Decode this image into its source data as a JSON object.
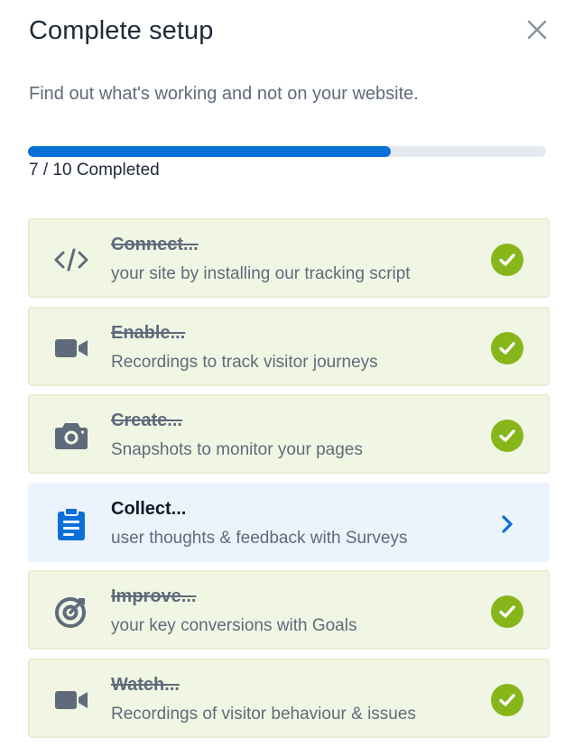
{
  "header": {
    "title": "Complete setup",
    "subtitle": "Find out what's working and not on your website."
  },
  "progress": {
    "completed": 7,
    "total": 10,
    "fraction": 0.7,
    "label": "7 / 10 Completed",
    "fill_color": "#0a6fd6"
  },
  "tasks": [
    {
      "title": "Connect...",
      "description": "your site by installing our tracking script",
      "icon": "code-icon",
      "status": "completed"
    },
    {
      "title": "Enable...",
      "description": "Recordings to track visitor journeys",
      "icon": "video-camera-icon",
      "status": "completed"
    },
    {
      "title": "Create...",
      "description": "Snapshots to monitor your pages",
      "icon": "camera-icon",
      "status": "completed"
    },
    {
      "title": "Collect...",
      "description": "user thoughts & feedback with Surveys",
      "icon": "clipboard-icon",
      "status": "active"
    },
    {
      "title": "Improve...",
      "description": "your key conversions with Goals",
      "icon": "target-icon",
      "status": "completed"
    },
    {
      "title": "Watch...",
      "description": "Recordings of visitor behaviour & issues",
      "icon": "video-camera-icon",
      "status": "completed"
    }
  ],
  "colors": {
    "completed_bg": "#f1f6e4",
    "active_bg": "#ebf4fd",
    "check_green": "#86b61a",
    "accent_blue": "#0a6fd6"
  }
}
